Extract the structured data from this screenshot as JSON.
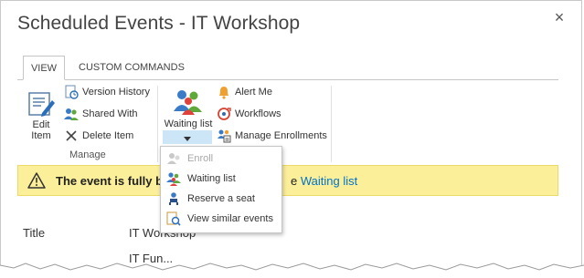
{
  "dialog": {
    "title": "Scheduled Events - IT Workshop",
    "close_glyph": "×"
  },
  "tabs": [
    {
      "label": "VIEW",
      "active": true
    },
    {
      "label": "CUSTOM COMMANDS",
      "active": false
    }
  ],
  "ribbon": {
    "manage_group": {
      "label": "Manage",
      "edit_item": {
        "label_line1": "Edit",
        "label_line2": "Item",
        "icon": "edit-item-icon"
      },
      "version_history": {
        "label": "Version History",
        "icon": "version-history-icon"
      },
      "shared_with": {
        "label": "Shared With",
        "icon": "shared-with-icon"
      },
      "delete_item": {
        "label": "Delete Item",
        "icon": "delete-item-icon"
      }
    },
    "actions_group": {
      "waiting_list": {
        "label": "Waiting list",
        "icon": "waiting-list-icon"
      },
      "alert_me": {
        "label": "Alert Me",
        "icon": "bell-icon"
      },
      "workflows": {
        "label": "Workflows",
        "icon": "workflows-icon"
      },
      "manage_enrollments": {
        "label": "Manage Enrollments",
        "icon": "manage-enrollments-icon"
      }
    }
  },
  "dropdown": {
    "items": [
      {
        "label": "Enroll",
        "disabled": true,
        "icon": "enroll-icon"
      },
      {
        "label": "Waiting list",
        "disabled": false,
        "icon": "waiting-list-icon"
      },
      {
        "label": "Reserve a seat",
        "disabled": false,
        "icon": "reserve-seat-icon"
      },
      {
        "label": "View similar events",
        "disabled": false,
        "icon": "view-similar-icon"
      }
    ]
  },
  "banner": {
    "message": "The event is fully b",
    "link_prefix": "e",
    "link_text": "Waiting list",
    "icon": "warning-icon"
  },
  "fields": {
    "title_label": "Title",
    "title_value": "IT Workshop",
    "next_value": "IT Fun..."
  },
  "colors": {
    "accent": "#0072c6",
    "banner_bg": "#fbef9a",
    "split_highlight": "#cde6f7"
  }
}
